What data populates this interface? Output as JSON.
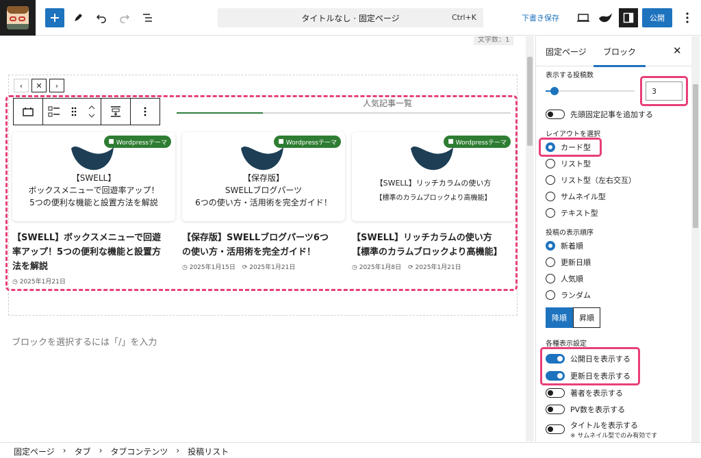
{
  "header": {
    "document_title": "タイトルなし · 固定ページ",
    "shortcut": "Ctrl+K",
    "draft_label": "下書き保存",
    "publish_label": "公開"
  },
  "editor": {
    "word_count": "文字数：1",
    "ranking_heading": "人気記事一覧",
    "placeholder": "ブロックを選択するには「/」を入力",
    "cards": [
      {
        "category": "Wordpressテーマ",
        "thumb_lines": [
          "【SWELL】",
          "ボックスメニューで回遊率アップ！",
          "5つの便利な機能と設置方法を解説"
        ],
        "title_lines": [
          "【SWELL】ボックスメニューで回遊",
          "率アップ！5つの便利な機能と設置方",
          "法を解説"
        ],
        "published": "2025年1月21日",
        "updated": ""
      },
      {
        "category": "Wordpressテーマ",
        "thumb_lines": [
          "【保存版】",
          "SWELLブログパーツ",
          "6つの使い方・活用術を完全ガイド！"
        ],
        "title_lines": [
          "【保存版】SWELLブログパーツ6つ",
          "の使い方・活用術を完全ガイド！"
        ],
        "published": "2025年1月15日",
        "updated": "2025年1月21日"
      },
      {
        "category": "Wordpressテーマ",
        "thumb_lines": [
          "【SWELL】リッチカラムの使い方",
          "【標準のカラムブロックより高機能】"
        ],
        "title_lines": [
          "【SWELL】リッチカラムの使い方",
          "【標準のカラムブロックより高機能】"
        ],
        "published": "2025年1月8日",
        "updated": "2025年1月21日"
      }
    ]
  },
  "breadcrumb": [
    "固定ページ",
    "タブ",
    "タブコンテンツ",
    "投稿リスト"
  ],
  "sidebar": {
    "tab_page": "固定ページ",
    "tab_block": "ブロック",
    "posts_label": "表示する投稿数",
    "posts_count": "3",
    "posts_count_fraction": 0.1,
    "sticky_label": "先頭固定記事を追加する",
    "layout_label": "レイアウトを選択",
    "layouts": [
      "カード型",
      "リスト型",
      "リスト型（左右交互）",
      "サムネイル型",
      "テキスト型"
    ],
    "order_label": "投稿の表示順序",
    "orders": [
      "新着順",
      "更新日順",
      "人気順",
      "ランダム"
    ],
    "sort_desc": "降順",
    "sort_asc": "昇順",
    "display_label": "各種表示設定",
    "show_published": "公開日を表示する",
    "show_updated": "更新日を表示する",
    "show_author": "著者を表示する",
    "show_pv": "PV数を表示する",
    "show_title": "タイトルを表示する",
    "show_title_note": "※ サムネイル型でのみ有効です"
  },
  "colors": {
    "accent": "#1e73be",
    "highlight": "#e83e7a",
    "category": "#2e7d32"
  }
}
